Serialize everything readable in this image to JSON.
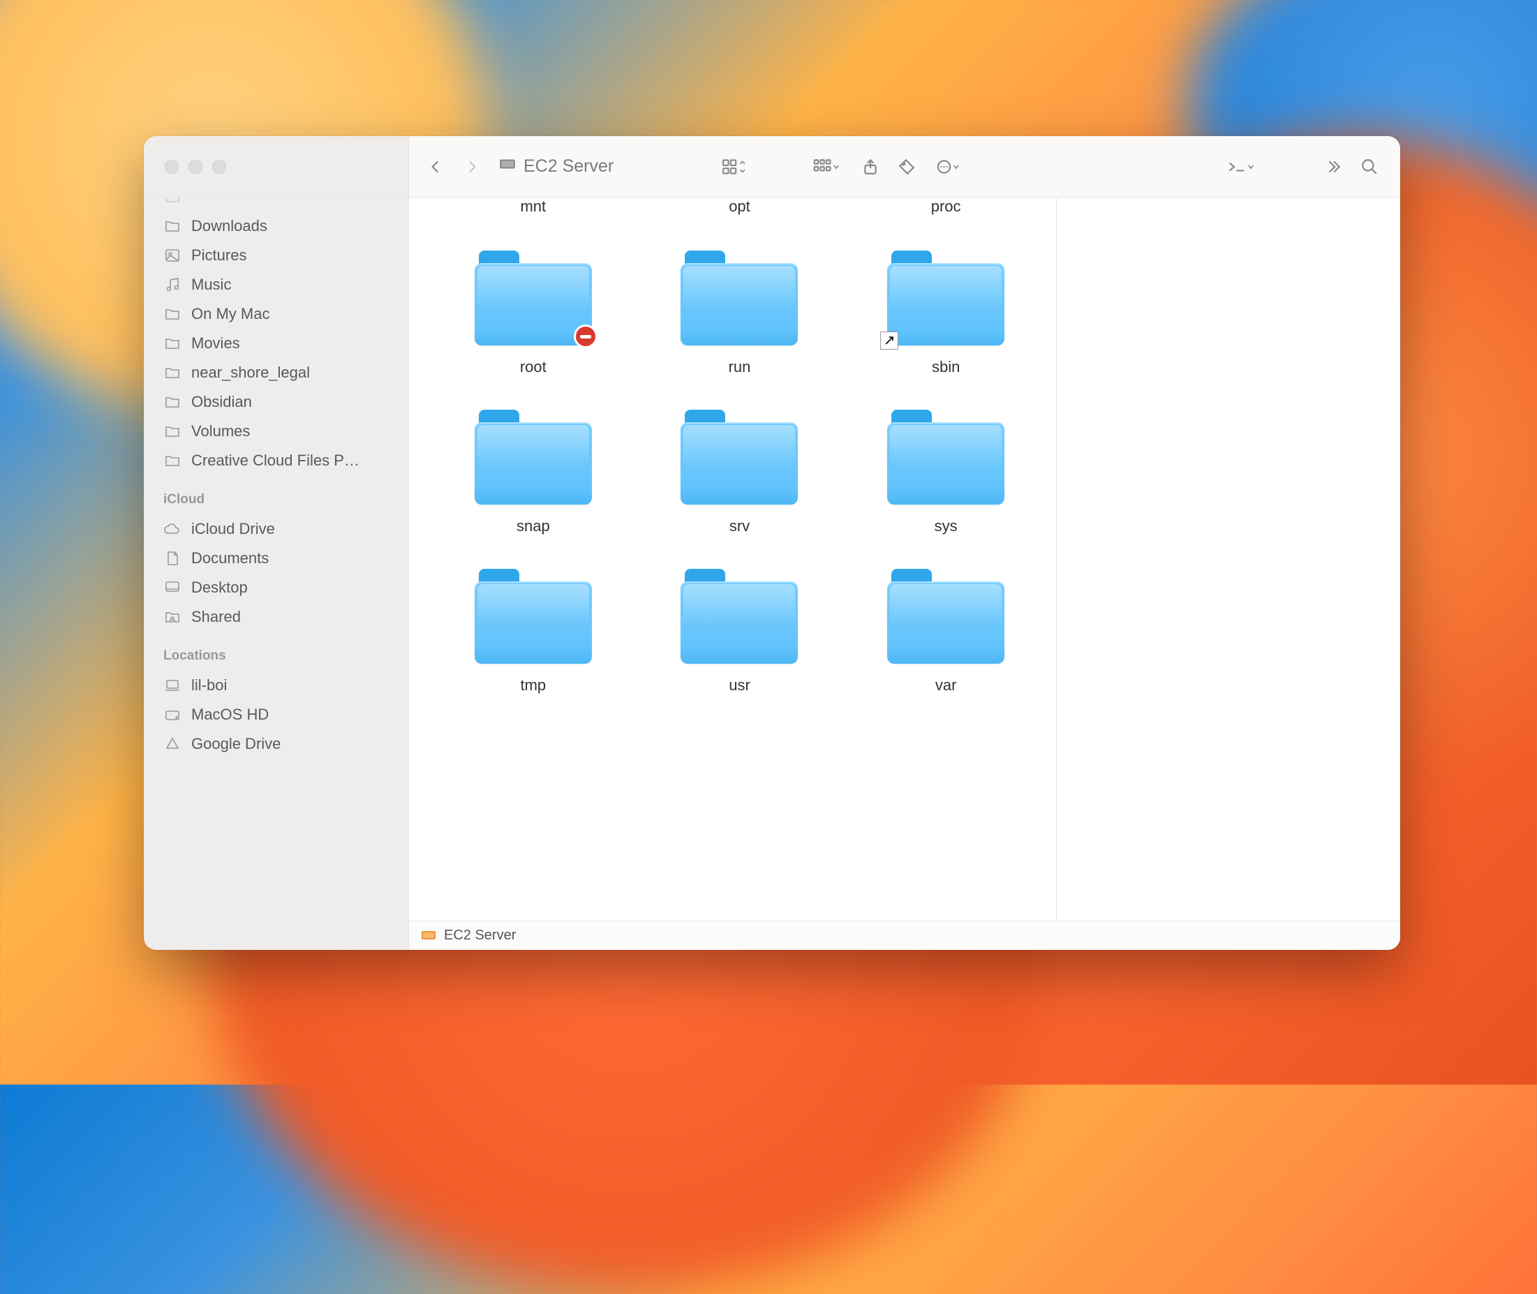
{
  "toolbar": {
    "title": "EC2 Server"
  },
  "sidebar": {
    "favorites": [
      {
        "label": "Downloads",
        "icon": "folder"
      },
      {
        "label": "Pictures",
        "icon": "image"
      },
      {
        "label": "Music",
        "icon": "music"
      },
      {
        "label": "On My Mac",
        "icon": "folder"
      },
      {
        "label": "Movies",
        "icon": "folder"
      },
      {
        "label": "near_shore_legal",
        "icon": "folder"
      },
      {
        "label": "Obsidian",
        "icon": "folder"
      },
      {
        "label": "Volumes",
        "icon": "folder"
      },
      {
        "label": "Creative Cloud Files P…",
        "icon": "folder"
      }
    ],
    "icloud_header": "iCloud",
    "icloud": [
      {
        "label": "iCloud Drive",
        "icon": "cloud"
      },
      {
        "label": "Documents",
        "icon": "doc"
      },
      {
        "label": "Desktop",
        "icon": "desktop"
      },
      {
        "label": "Shared",
        "icon": "shared"
      }
    ],
    "locations_header": "Locations",
    "locations": [
      {
        "label": "lil-boi",
        "icon": "laptop"
      },
      {
        "label": "MacOS HD",
        "icon": "disk"
      },
      {
        "label": "Google Drive",
        "icon": "gdrive"
      }
    ]
  },
  "folders_row0": [
    {
      "name": "mnt"
    },
    {
      "name": "opt"
    },
    {
      "name": "proc"
    }
  ],
  "folders": [
    {
      "name": "root",
      "badge": "denied"
    },
    {
      "name": "run"
    },
    {
      "name": "sbin",
      "badge": "alias"
    },
    {
      "name": "snap"
    },
    {
      "name": "srv"
    },
    {
      "name": "sys"
    },
    {
      "name": "tmp"
    },
    {
      "name": "usr"
    },
    {
      "name": "var"
    }
  ],
  "pathbar": {
    "label": "EC2 Server"
  }
}
